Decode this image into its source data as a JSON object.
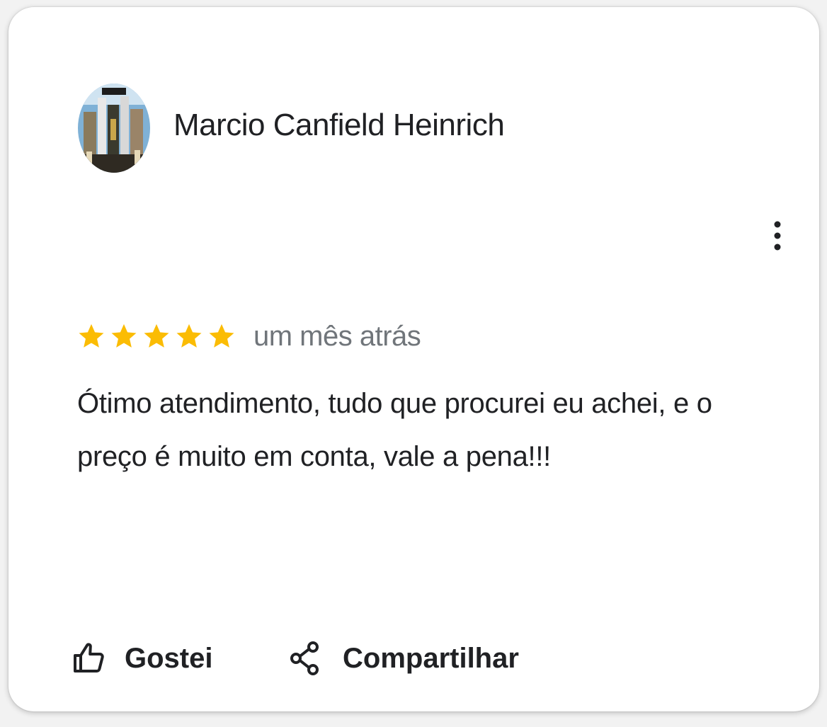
{
  "review": {
    "author_name": "Marcio Canfield Heinrich",
    "rating": 5,
    "max_rating": 5,
    "date": "um mês atrás",
    "text": "Ótimo atendimento, tudo que procurei eu achei, e o preço é muito em conta, vale a pena!!!"
  },
  "actions": {
    "like_label": "Gostei",
    "share_label": "Compartilhar"
  },
  "icons": {
    "avatar": "avatar-photo",
    "more": "more-vert-icon",
    "star": "star-icon",
    "like": "thumb-up-icon",
    "share": "share-icon"
  },
  "colors": {
    "star": "#fbbc04",
    "text": "#202124",
    "secondary_text": "#70757a"
  }
}
